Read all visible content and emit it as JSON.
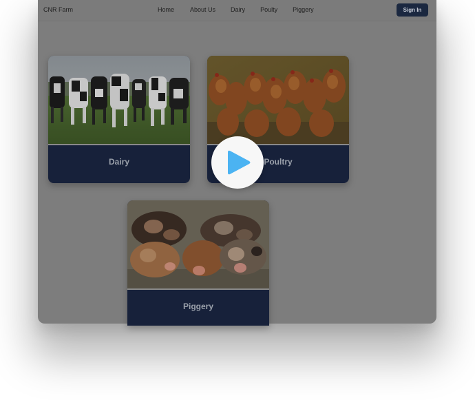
{
  "nav": {
    "brand": "CNR Farm",
    "links": [
      "Home",
      "About Us",
      "Dairy",
      "Poulty",
      "Piggery"
    ],
    "signin_label": "Sign In"
  },
  "cards": [
    {
      "label": "Dairy",
      "image": "dairy-cows-photo"
    },
    {
      "label": "Poultry",
      "image": "poultry-hens-photo"
    },
    {
      "label": "Piggery",
      "image": "piggery-piglets-photo"
    }
  ],
  "overlay": {
    "play_icon": "play-icon",
    "accent": "#4bb3f2"
  },
  "colors": {
    "card_footer": "#17213a",
    "signin_button": "#1b2840",
    "dim_overlay": "#7d7d7d"
  }
}
